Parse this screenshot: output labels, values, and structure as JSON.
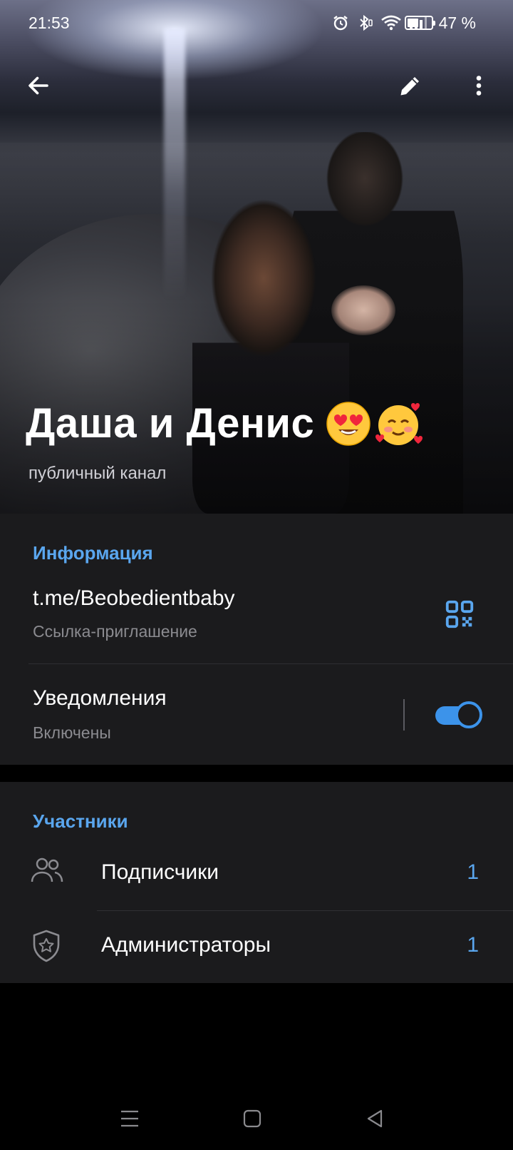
{
  "status_bar": {
    "time": "21:53",
    "battery_percent_text": "47 %",
    "battery_level": 0.47,
    "icons": [
      "alarm-icon",
      "bluetooth-icon",
      "wifi-icon",
      "signal-icon",
      "battery-icon"
    ]
  },
  "toolbar": {
    "icons": [
      "back-arrow-icon",
      "pencil-icon",
      "more-vertical-icon"
    ]
  },
  "channel": {
    "title": "Даша и Денис",
    "emojis": [
      "heart-eyes-emoji",
      "smiling-face-with-hearts-emoji"
    ],
    "subtitle": "публичный канал"
  },
  "info_section": {
    "header": "Информация",
    "link": "t.me/Beobedientbaby",
    "link_caption": "Ссылка-приглашение",
    "notifications_title": "Уведомления",
    "notifications_status": "Включены",
    "notifications_enabled": true
  },
  "members_section": {
    "header": "Участники",
    "items": [
      {
        "label": "Подписчики",
        "count": "1",
        "icon": "people-icon"
      },
      {
        "label": "Администраторы",
        "count": "1",
        "icon": "shield-star-icon"
      }
    ]
  },
  "navigation_bar": {
    "icons": [
      "menu-icon",
      "home-icon",
      "back-triangle-icon"
    ]
  },
  "colors": {
    "accent": "#5aa6ee",
    "toggle": "#3c93ea",
    "section_bg": "#1b1b1d",
    "secondary_text": "#8b8b90"
  }
}
